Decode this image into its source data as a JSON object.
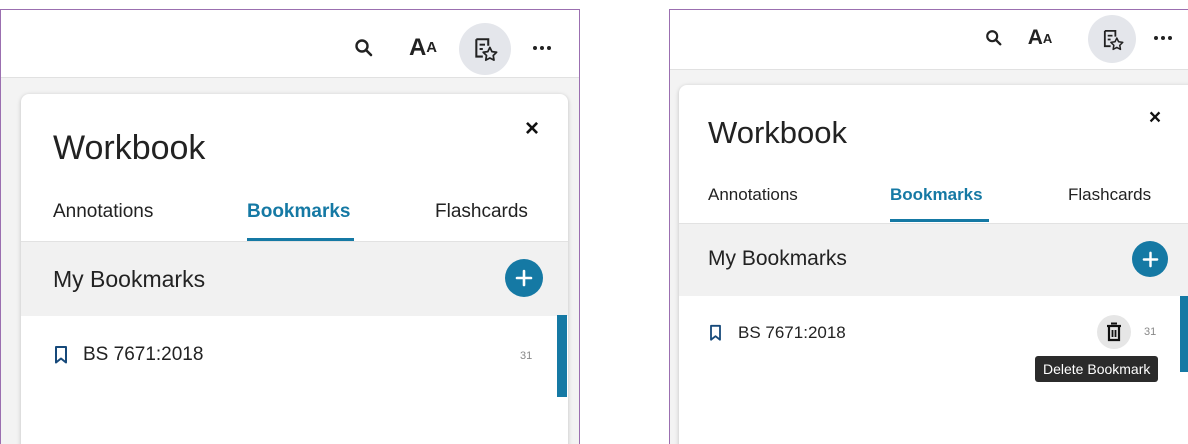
{
  "toolbar": {
    "search_icon": "search-icon",
    "font_size_label_big": "A",
    "font_size_label_small": "A",
    "workbook_icon": "workbook-star-icon",
    "more_icon": "more-horizontal-icon"
  },
  "panel": {
    "title": "Workbook",
    "close_label": "×",
    "tabs": [
      {
        "label": "Annotations"
      },
      {
        "label": "Bookmarks"
      },
      {
        "label": "Flashcards"
      }
    ],
    "active_tab": "Bookmarks",
    "section_title": "My Bookmarks",
    "add_label": "+",
    "bookmarks": [
      {
        "label": "BS 7671:2018",
        "page": "31"
      }
    ],
    "delete_tooltip": "Delete Bookmark"
  },
  "colors": {
    "accent": "#1579a4",
    "frame_border": "#9b6fb0",
    "header_bg": "#f1f1f1",
    "tooltip_bg": "#2b2b2b"
  }
}
